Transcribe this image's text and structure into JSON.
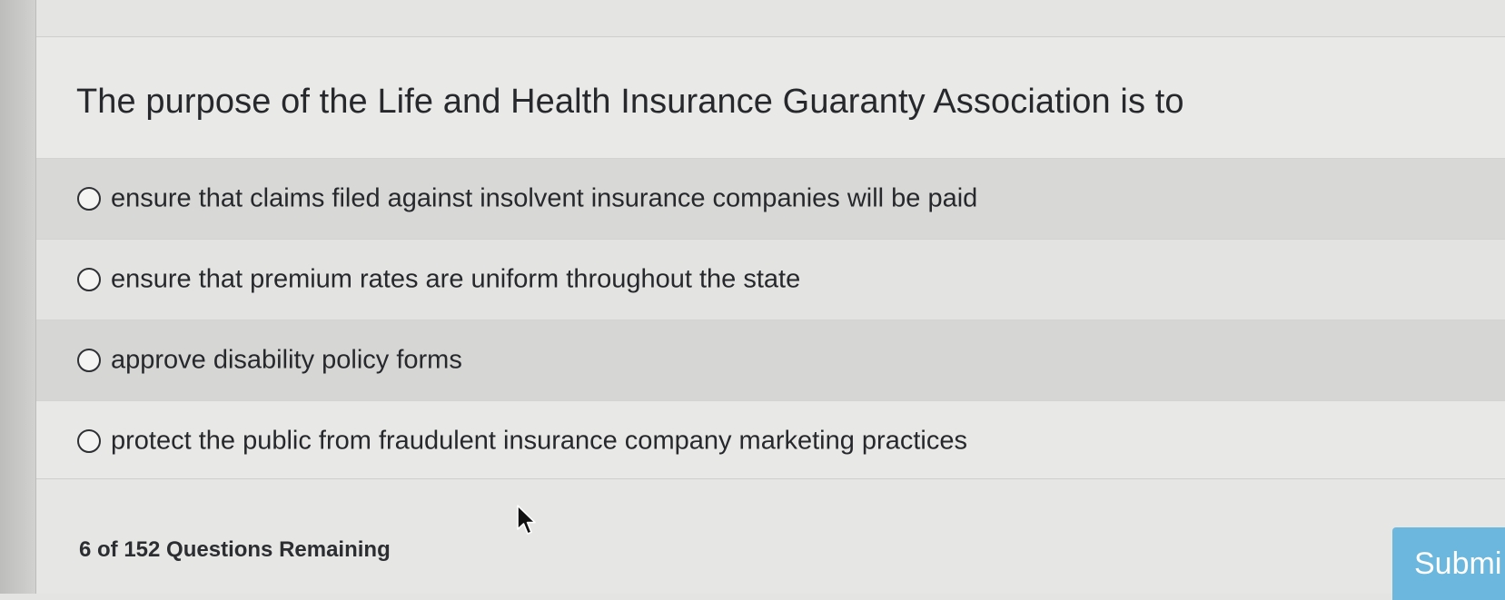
{
  "question": {
    "text": "The purpose of the Life and Health Insurance Guaranty Association is to"
  },
  "options": [
    {
      "label": "ensure that claims filed against insolvent insurance companies will be paid",
      "selected": false
    },
    {
      "label": "ensure that premium rates are uniform throughout the state",
      "selected": false
    },
    {
      "label": "approve disability policy forms",
      "selected": false
    },
    {
      "label": "protect the public from fraudulent insurance company marketing practices",
      "selected": false
    }
  ],
  "footer": {
    "remaining_text": "6 of 152 Questions Remaining",
    "submit_label": "Submi"
  },
  "colors": {
    "submit_button": "#6bb7dd",
    "text": "#26282b"
  },
  "icons": {
    "radio": "radio-unchecked-icon",
    "pointer": "mouse-pointer-icon"
  }
}
